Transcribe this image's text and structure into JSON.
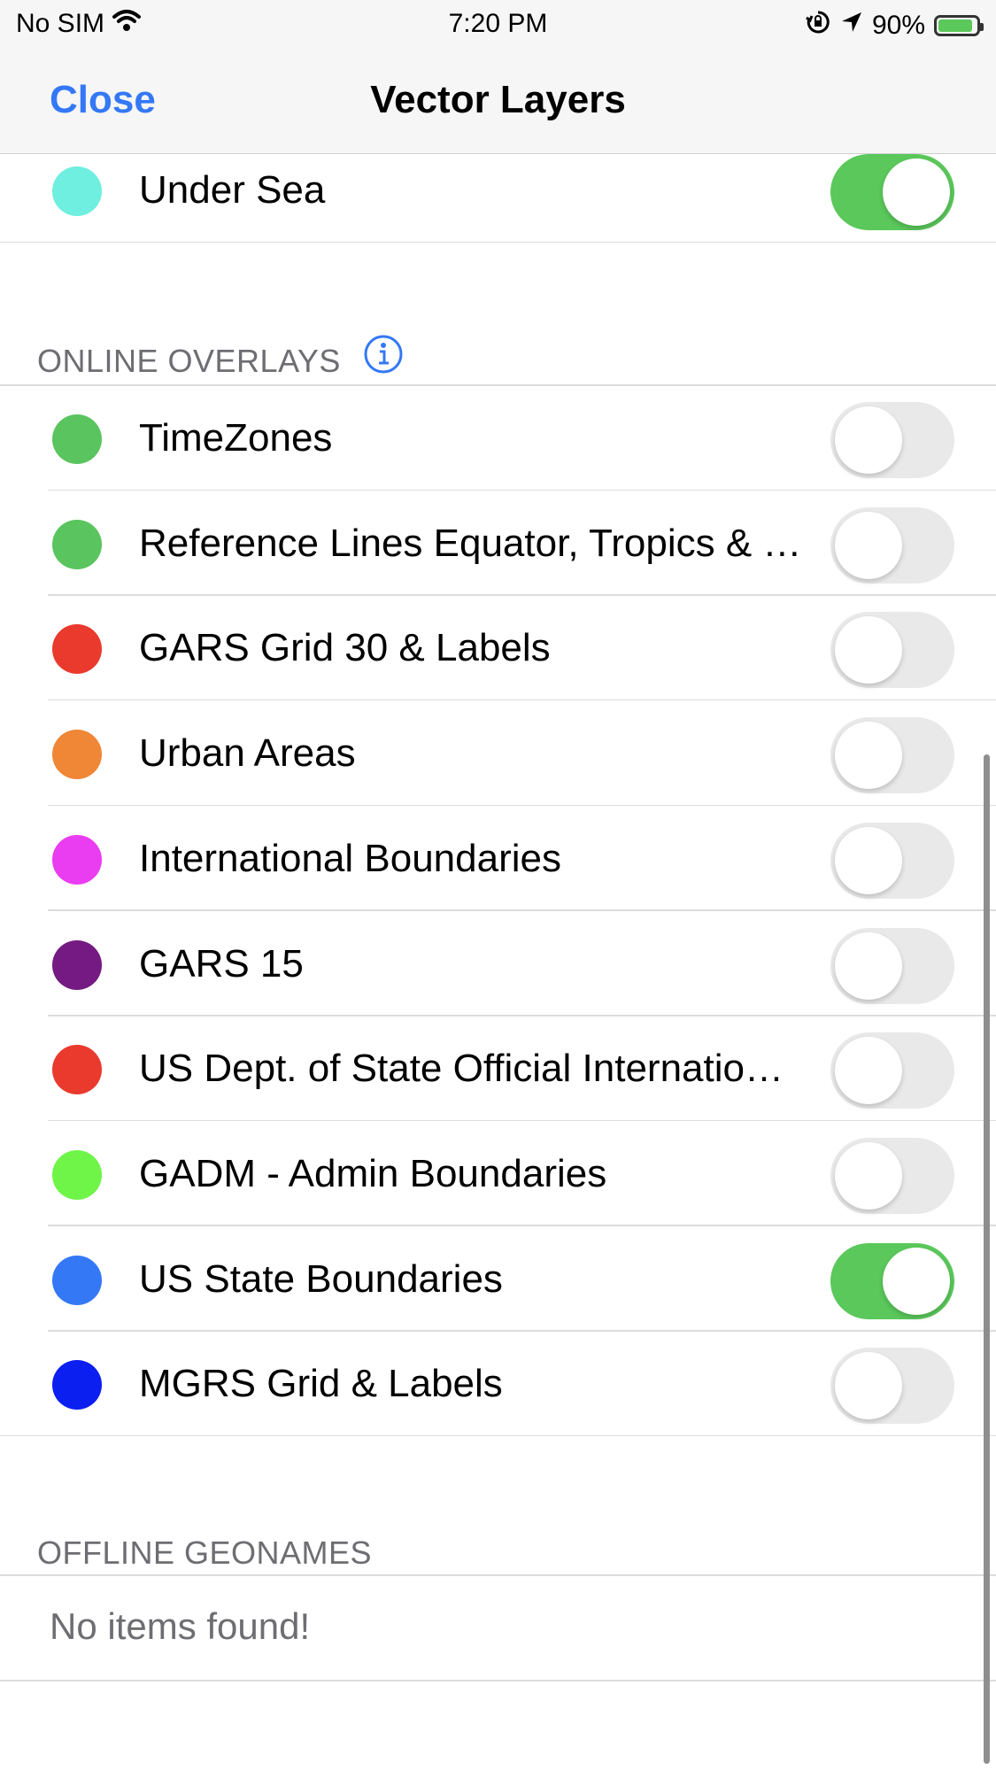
{
  "status_bar": {
    "carrier": "No SIM",
    "time": "7:20 PM",
    "battery_percent": "90%",
    "battery_level": 0.9,
    "icons": [
      "wifi-icon",
      "orientation-lock-icon",
      "location-arrow-icon",
      "battery-charging-icon"
    ]
  },
  "nav": {
    "close_label": "Close",
    "title": "Vector Layers"
  },
  "colors": {
    "accent": "#3478f6",
    "toggle_on": "#5ac85a",
    "toggle_off": "#e9e9ea"
  },
  "top_item": {
    "label": "Under Sea",
    "color": "#6eefe0",
    "enabled": true
  },
  "online_overlays": {
    "header": "ONLINE OVERLAYS",
    "info_icon": "info-icon",
    "items": [
      {
        "label": "TimeZones",
        "color": "#5ac45e",
        "enabled": false
      },
      {
        "label": "Reference Lines Equator, Tropics & Polar Circles",
        "color": "#5ac45e",
        "enabled": false
      },
      {
        "label": "GARS Grid 30 & Labels",
        "color": "#e93a2d",
        "enabled": false
      },
      {
        "label": "Urban Areas",
        "color": "#ef8736",
        "enabled": false
      },
      {
        "label": "International Boundaries",
        "color": "#ea3cf0",
        "enabled": false
      },
      {
        "label": "GARS 15",
        "color": "#741a82",
        "enabled": false
      },
      {
        "label": "US Dept. of State Official International Boundaries",
        "color": "#e93a2d",
        "enabled": false
      },
      {
        "label": "GADM - Admin Boundaries",
        "color": "#6ef548",
        "enabled": false
      },
      {
        "label": "US State Boundaries",
        "color": "#3478f6",
        "enabled": true
      },
      {
        "label": "MGRS Grid & Labels",
        "color": "#0b1ff0",
        "enabled": false
      }
    ]
  },
  "offline_geonames": {
    "header": "OFFLINE GEONAMES",
    "empty_text": "No items found!"
  }
}
